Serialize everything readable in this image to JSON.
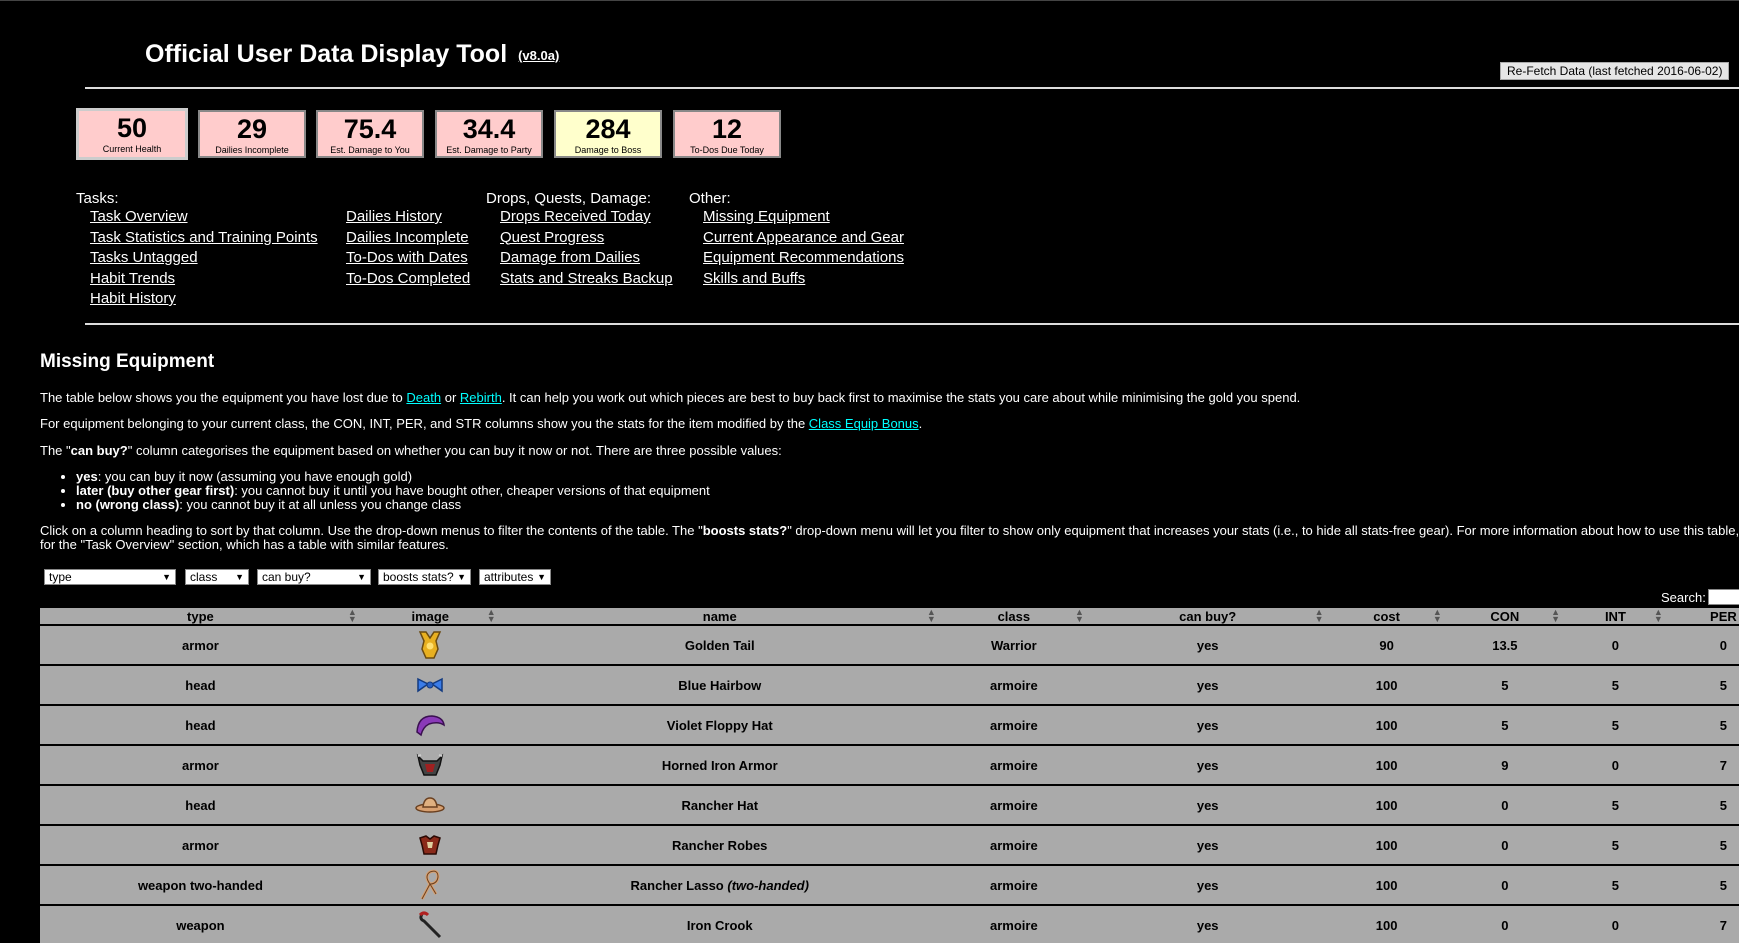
{
  "header": {
    "title": "Official User Data Display Tool",
    "version": "(v8.0a)",
    "refetch_label": "Re-Fetch Data (last fetched 2016-06-02)"
  },
  "stats": [
    {
      "value": "50",
      "label": "Current Health",
      "color": "#ffcccc"
    },
    {
      "value": "29",
      "label": "Dailies Incomplete",
      "color": "#ffcccc"
    },
    {
      "value": "75.4",
      "label": "Est. Damage to You",
      "color": "#ffcccc"
    },
    {
      "value": "34.4",
      "label": "Est. Damage to Party",
      "color": "#ffcccc"
    },
    {
      "value": "284",
      "label": "Damage to Boss",
      "color": "#ffffcc"
    },
    {
      "value": "12",
      "label": "To-Dos Due Today",
      "color": "#ffcccc"
    }
  ],
  "nav": {
    "tasks_heading": "Tasks:",
    "tasks": [
      "Task Overview",
      "Task Statistics and Training Points",
      "Tasks Untagged",
      "Habit Trends",
      "Habit History"
    ],
    "dailies": [
      "Dailies History",
      "Dailies Incomplete",
      "To-Dos with Dates",
      "To-Dos Completed"
    ],
    "drops_heading": "Drops, Quests, Damage:",
    "drops": [
      "Drops Received Today",
      "Quest Progress",
      "Damage from Dailies",
      "Stats and Streaks Backup"
    ],
    "other_heading": "Other:",
    "other": [
      "Missing Equipment",
      "Current Appearance and Gear",
      "Equipment Recommendations",
      "Skills and Buffs"
    ]
  },
  "section": {
    "title": "Missing Equipment",
    "p1_pre": "The table below shows you the equipment you have lost due to ",
    "p1_link1": "Death",
    "p1_mid": " or ",
    "p1_link2": "Rebirth",
    "p1_post": ". It can help you work out which pieces are best to buy back first to maximise the stats you care about while minimising the gold you spend.",
    "p2_pre": "For equipment belonging to your current class, the CON, INT, PER, and STR columns show you the stats for the item modified by the ",
    "p2_link": "Class Equip Bonus",
    "p2_post": ".",
    "p3_pre": "The \"",
    "p3_bold": "can buy?",
    "p3_post": "\" column categorises the equipment based on whether you can buy it now or not. There are three possible values:",
    "bullets": [
      {
        "bold": "yes",
        "text": ": you can buy it now (assuming you have enough gold)"
      },
      {
        "bold": "later (buy other gear first)",
        "text": ": you cannot buy it until you have bought other, cheaper versions of that equipment"
      },
      {
        "bold": "no (wrong class)",
        "text": ": you cannot buy it at all unless you change class"
      }
    ],
    "p4_pre": "Click on a column heading to sort by that column. Use the drop-down menus to filter the contents of the table. The \"",
    "p4_bold": "boosts stats?",
    "p4_post": "\" drop-down menu will let you filter to show only equipment that increases your stats (i.e., to hide all stats-free gear). For more information about how to use this table, re",
    "p4_line2": "for the \"Task Overview\" section, which has a table with similar features."
  },
  "filters": [
    {
      "label": "type"
    },
    {
      "label": "class"
    },
    {
      "label": "can buy?"
    },
    {
      "label": "boosts stats?"
    },
    {
      "label": "attributes"
    }
  ],
  "search_label": "Search:",
  "table": {
    "columns": [
      "type",
      "image",
      "name",
      "class",
      "can buy?",
      "cost",
      "CON",
      "INT",
      "PER"
    ],
    "rows": [
      {
        "type": "armor",
        "icon": "golden-tail-icon",
        "name": "Golden Tail",
        "name_suffix": "",
        "class": "Warrior",
        "can_buy": "yes",
        "cost": "90",
        "con": "13.5",
        "int": "0",
        "per": "0"
      },
      {
        "type": "head",
        "icon": "blue-hairbow-icon",
        "name": "Blue Hairbow",
        "name_suffix": "",
        "class": "armoire",
        "can_buy": "yes",
        "cost": "100",
        "con": "5",
        "int": "5",
        "per": "5"
      },
      {
        "type": "head",
        "icon": "violet-floppy-hat-icon",
        "name": "Violet Floppy Hat",
        "name_suffix": "",
        "class": "armoire",
        "can_buy": "yes",
        "cost": "100",
        "con": "5",
        "int": "5",
        "per": "5"
      },
      {
        "type": "armor",
        "icon": "horned-iron-armor-icon",
        "name": "Horned Iron Armor",
        "name_suffix": "",
        "class": "armoire",
        "can_buy": "yes",
        "cost": "100",
        "con": "9",
        "int": "0",
        "per": "7"
      },
      {
        "type": "head",
        "icon": "rancher-hat-icon",
        "name": "Rancher Hat",
        "name_suffix": "",
        "class": "armoire",
        "can_buy": "yes",
        "cost": "100",
        "con": "0",
        "int": "5",
        "per": "5"
      },
      {
        "type": "armor",
        "icon": "rancher-robes-icon",
        "name": "Rancher Robes",
        "name_suffix": "",
        "class": "armoire",
        "can_buy": "yes",
        "cost": "100",
        "con": "0",
        "int": "5",
        "per": "5"
      },
      {
        "type": "weapon two-handed",
        "icon": "rancher-lasso-icon",
        "name": "Rancher Lasso ",
        "name_suffix": "(two-handed)",
        "class": "armoire",
        "can_buy": "yes",
        "cost": "100",
        "con": "0",
        "int": "5",
        "per": "5"
      },
      {
        "type": "weapon",
        "icon": "iron-crook-icon",
        "name": "Iron Crook",
        "name_suffix": "",
        "class": "armoire",
        "can_buy": "yes",
        "cost": "100",
        "con": "0",
        "int": "0",
        "per": "7"
      }
    ]
  }
}
